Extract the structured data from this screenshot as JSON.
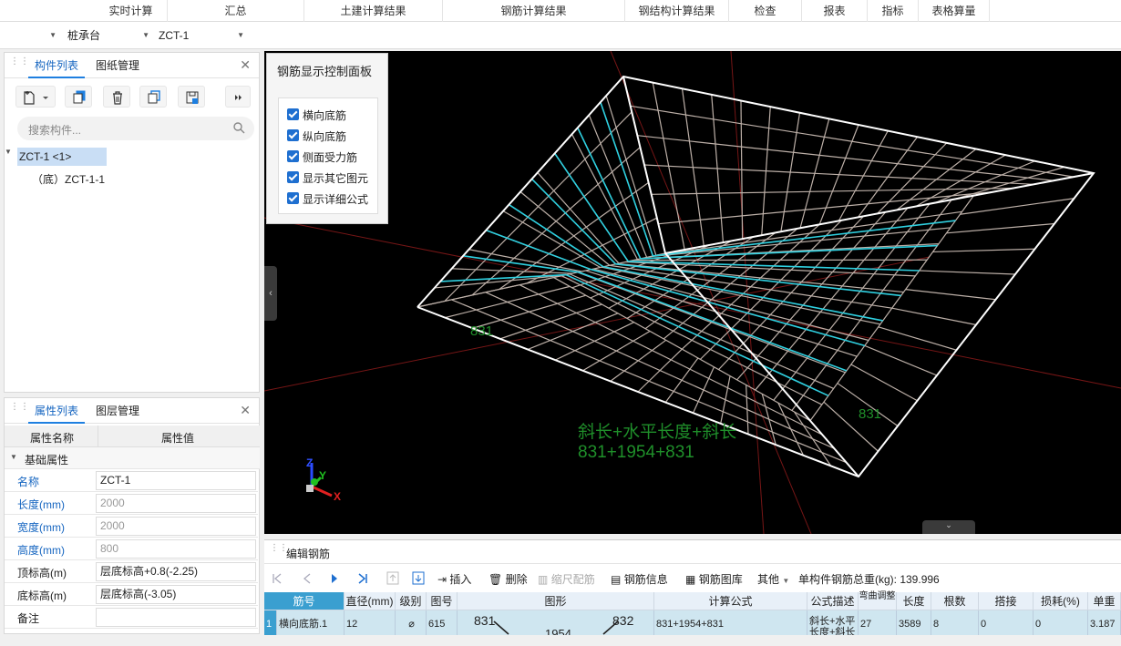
{
  "menu": {
    "items": [
      "实时计算",
      "汇总",
      "土建计算结果",
      "钢筋计算结果",
      "钢结构计算结果",
      "检查",
      "报表",
      "指标",
      "表格算量"
    ]
  },
  "selectors": {
    "component_type": "桩承台",
    "component_name": "ZCT-1"
  },
  "component_panel": {
    "tabs": [
      "构件列表",
      "图纸管理"
    ],
    "search_placeholder": "搜索构件...",
    "tree": {
      "root": "ZCT-1 <1>",
      "child": "（底）ZCT-1-1"
    }
  },
  "property_panel": {
    "tabs": [
      "属性列表",
      "图层管理"
    ],
    "col_name": "属性名称",
    "col_value": "属性值",
    "group": "基础属性",
    "rows": [
      {
        "name": "名称",
        "value": "ZCT-1"
      },
      {
        "name": "长度(mm)",
        "value": "2000"
      },
      {
        "name": "宽度(mm)",
        "value": "2000"
      },
      {
        "name": "高度(mm)",
        "value": "800"
      },
      {
        "name": "顶标高(m)",
        "value": "层底标高+0.8(-2.25)"
      },
      {
        "name": "底标高(m)",
        "value": "层底标高(-3.05)"
      },
      {
        "name": "备注",
        "value": ""
      }
    ]
  },
  "control_panel": {
    "title": "钢筋显示控制面板",
    "options": [
      "横向底筋",
      "纵向底筋",
      "侧面受力筋",
      "显示其它图元",
      "显示详细公式"
    ]
  },
  "viewport": {
    "label_small_left": "831",
    "label_small_right": "831",
    "formula_text": "斜长+水平长度+斜长",
    "formula_values": "831+1954+831",
    "axes": {
      "z": "Z",
      "y": "Y",
      "x": "X"
    }
  },
  "edit_rebar": {
    "title": "编辑钢筋",
    "toolbar": {
      "insert": "插入",
      "delete": "删除",
      "scale": "缩尺配筋",
      "rebar_info": "钢筋信息",
      "rebar_lib": "钢筋图库",
      "other": "其他",
      "total_label": "单构件钢筋总重(kg): 139.996"
    },
    "columns": [
      "筋号",
      "直径(mm)",
      "级别",
      "图号",
      "图形",
      "计算公式",
      "公式描述",
      "弯曲调整",
      "长度",
      "根数",
      "搭接",
      "损耗(%)",
      "单重"
    ],
    "row": {
      "index": "1",
      "bar_no": "横向底筋.1",
      "diameter": "12",
      "grade": "⌀",
      "fig_no": "615",
      "shape_left": "831",
      "shape_mid": "1954",
      "shape_right": "832",
      "formula": "831+1954+831",
      "desc": "斜长+水平长度+斜长",
      "bend": "27",
      "length": "3589",
      "count": "8",
      "lap": "0",
      "loss": "0",
      "unit_wt": "3.187"
    }
  }
}
